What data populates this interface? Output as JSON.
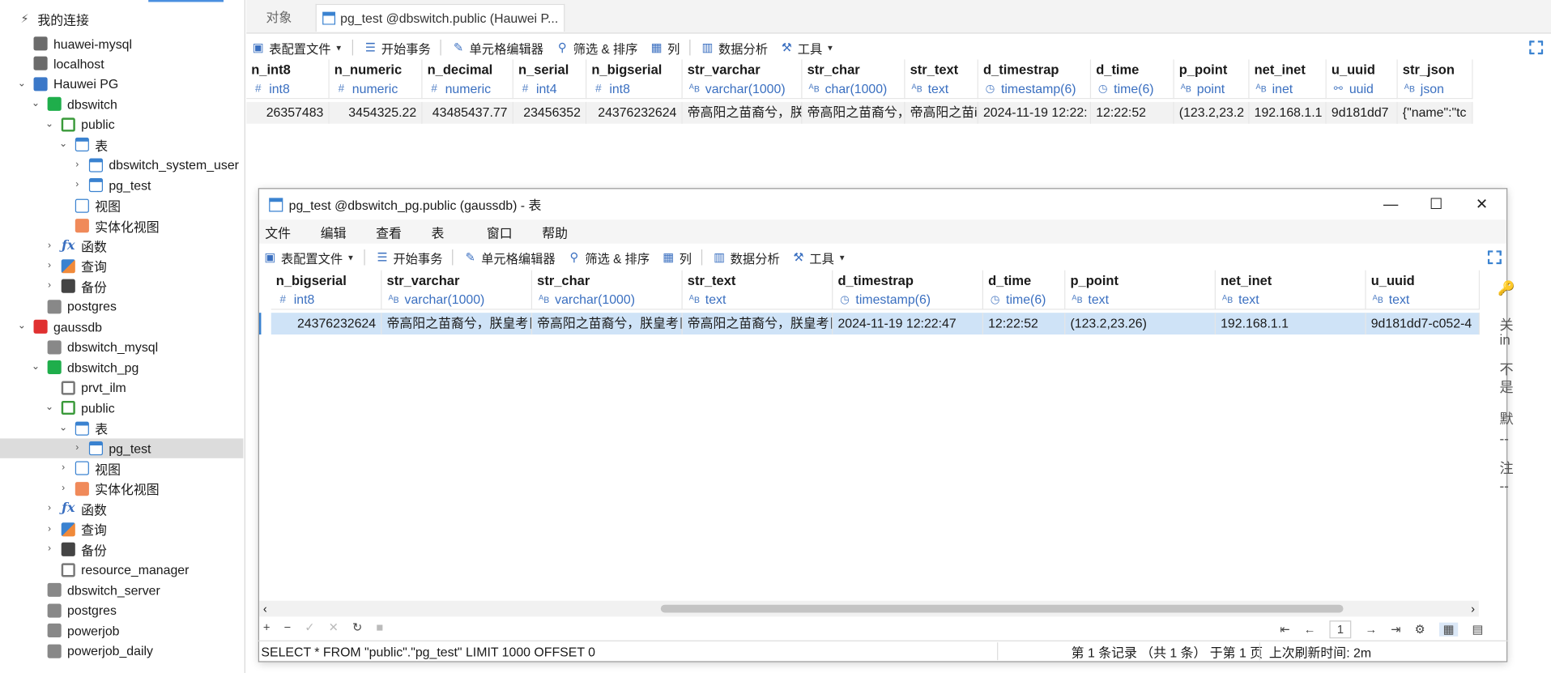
{
  "sidebar": {
    "title": "我的连接",
    "items": [
      {
        "label": "huawei-mysql",
        "icon": "host-icon"
      },
      {
        "label": "localhost",
        "icon": "host-icon"
      },
      {
        "label": "Hauwei PG",
        "icon": "postgres-icon"
      },
      {
        "label": "dbswitch",
        "icon": "database-icon"
      },
      {
        "label": "public",
        "icon": "schema-icon"
      },
      {
        "label": "表",
        "icon": "table-folder-icon"
      },
      {
        "label": "dbswitch_system_user",
        "icon": "table-icon"
      },
      {
        "label": "pg_test",
        "icon": "table-icon"
      },
      {
        "label": "视图",
        "icon": "view-icon"
      },
      {
        "label": "实体化视图",
        "icon": "materialized-view-icon"
      },
      {
        "label": "函数",
        "icon": "function-icon"
      },
      {
        "label": "查询",
        "icon": "query-icon"
      },
      {
        "label": "备份",
        "icon": "backup-icon"
      },
      {
        "label": "postgres",
        "icon": "database-icon"
      },
      {
        "label": "gaussdb",
        "icon": "gaussdb-icon"
      },
      {
        "label": "dbswitch_mysql",
        "icon": "database-icon"
      },
      {
        "label": "dbswitch_pg",
        "icon": "database-icon"
      },
      {
        "label": "prvt_ilm",
        "icon": "schema-icon"
      },
      {
        "label": "public",
        "icon": "schema-icon"
      },
      {
        "label": "表",
        "icon": "table-folder-icon"
      },
      {
        "label": "pg_test",
        "icon": "table-icon"
      },
      {
        "label": "视图",
        "icon": "view-icon"
      },
      {
        "label": "实体化视图",
        "icon": "materialized-view-icon"
      },
      {
        "label": "函数",
        "icon": "function-icon"
      },
      {
        "label": "查询",
        "icon": "query-icon"
      },
      {
        "label": "备份",
        "icon": "backup-icon"
      },
      {
        "label": "resource_manager",
        "icon": "schema-icon"
      },
      {
        "label": "dbswitch_server",
        "icon": "database-icon"
      },
      {
        "label": "postgres",
        "icon": "database-icon"
      },
      {
        "label": "powerjob",
        "icon": "database-icon"
      },
      {
        "label": "powerjob_daily",
        "icon": "database-icon"
      }
    ]
  },
  "tabs": {
    "objects": "对象",
    "active": "pg_test @dbswitch.public (Hauwei P..."
  },
  "toolbar": {
    "profile": "表配置文件",
    "begin_tx": "开始事务",
    "cell_editor": "单元格编辑器",
    "filter_sort": "筛选 & 排序",
    "columns": "列",
    "analysis": "数据分析",
    "tools": "工具"
  },
  "top_grid": {
    "columns": [
      {
        "name": "n_int8",
        "type": "int8",
        "ticon": "#"
      },
      {
        "name": "n_numeric",
        "type": "numeric",
        "ticon": "#"
      },
      {
        "name": "n_decimal",
        "type": "numeric",
        "ticon": "#"
      },
      {
        "name": "n_serial",
        "type": "int4",
        "ticon": "#"
      },
      {
        "name": "n_bigserial",
        "type": "int8",
        "ticon": "#"
      },
      {
        "name": "str_varchar",
        "type": "varchar(1000)",
        "ticon": "ᴬʙ"
      },
      {
        "name": "str_char",
        "type": "char(1000)",
        "ticon": "ᴬʙ"
      },
      {
        "name": "str_text",
        "type": "text",
        "ticon": "ᴬʙ"
      },
      {
        "name": "d_timestrap",
        "type": "timestamp(6)",
        "ticon": "◷"
      },
      {
        "name": "d_time",
        "type": "time(6)",
        "ticon": "◷"
      },
      {
        "name": "p_point",
        "type": "point",
        "ticon": "ᴬʙ"
      },
      {
        "name": "net_inet",
        "type": "inet",
        "ticon": "ᴬʙ"
      },
      {
        "name": "u_uuid",
        "type": "uuid",
        "ticon": "⚯"
      },
      {
        "name": "str_json",
        "type": "json",
        "ticon": "ᴬʙ"
      }
    ],
    "row": [
      "26357483",
      "3454325.22",
      "43485437.77",
      "23456352",
      "24376232624",
      "帝高阳之苗裔兮，朕",
      "帝高阳之苗裔兮，",
      "帝高阳之苗i",
      "2024-11-19 12:22:",
      "12:22:52",
      "(123.2,23.2",
      "192.168.1.1",
      "9d181dd7",
      "{\"name\":\"tc"
    ]
  },
  "window": {
    "title": "pg_test @dbswitch_pg.public (gaussdb) - 表",
    "menu": [
      "文件",
      "编辑",
      "查看",
      "表",
      "窗口",
      "帮助"
    ],
    "columns": [
      {
        "name": "n_bigserial",
        "type": "int8",
        "ticon": "#"
      },
      {
        "name": "str_varchar",
        "type": "varchar(1000)",
        "ticon": "ᴬʙ"
      },
      {
        "name": "str_char",
        "type": "varchar(1000)",
        "ticon": "ᴬʙ"
      },
      {
        "name": "str_text",
        "type": "text",
        "ticon": "ᴬʙ"
      },
      {
        "name": "d_timestrap",
        "type": "timestamp(6)",
        "ticon": "◷"
      },
      {
        "name": "d_time",
        "type": "time(6)",
        "ticon": "◷"
      },
      {
        "name": "p_point",
        "type": "text",
        "ticon": "ᴬʙ"
      },
      {
        "name": "net_inet",
        "type": "text",
        "ticon": "ᴬʙ"
      },
      {
        "name": "u_uuid",
        "type": "text",
        "ticon": "ᴬʙ"
      }
    ],
    "row": [
      "24376232624",
      "帝高阳之苗裔兮，朕皇考日",
      "帝高阳之苗裔兮，朕皇考日",
      "帝高阳之苗裔兮，朕皇考日",
      "2024-11-19 12:22:47",
      "12:22:52",
      "(123.2,23.26)",
      "192.168.1.1",
      "9d181dd7-c052-4"
    ],
    "sql": "SELECT * FROM \"public\".\"pg_test\" LIMIT 1000 OFFSET 0",
    "record_info": "第 1 条记录 （共 1 条） 于第 1 页",
    "refresh": "上次刷新时间: 2m",
    "page": "1"
  },
  "right_strip": [
    "关",
    "in",
    "不",
    "是",
    "默",
    "--",
    "注",
    "--"
  ]
}
